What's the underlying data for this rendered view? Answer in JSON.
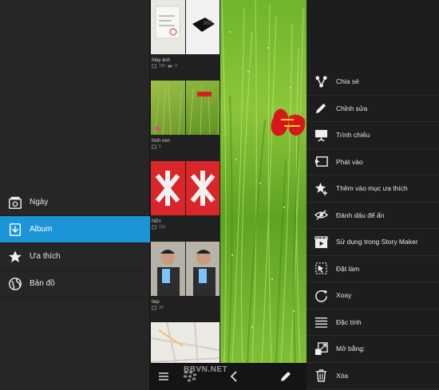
{
  "nav": {
    "items": [
      {
        "label": "Ngày",
        "icon": "calendar-photo-icon",
        "active": false
      },
      {
        "label": "Album",
        "icon": "album-icon",
        "active": true
      },
      {
        "label": "Ưa thích",
        "icon": "star-icon",
        "active": false
      },
      {
        "label": "Bản đồ",
        "icon": "globe-icon",
        "active": false
      }
    ]
  },
  "albums": [
    {
      "name": "Máy ảnh",
      "photos": "160",
      "videos": "6"
    },
    {
      "name": "hinh nen",
      "photos": "5"
    },
    {
      "name": "NEn",
      "photos": "102"
    },
    {
      "name": "tiep",
      "photos": "30"
    }
  ],
  "watermark": "BBVN.NET",
  "menu": {
    "items": [
      {
        "label": "Chia sẻ",
        "icon": "share-icon"
      },
      {
        "label": "Chỉnh sửa",
        "icon": "pencil-icon"
      },
      {
        "label": "Trình chiếu",
        "icon": "slideshow-icon"
      },
      {
        "label": "Phát vào",
        "icon": "play-on-icon"
      },
      {
        "label": "Thêm vào mục ưa thích",
        "icon": "add-favorite-icon"
      },
      {
        "label": "Đánh dấu để ẩn",
        "icon": "hide-icon"
      },
      {
        "label": "Sử dụng trong Story Maker",
        "icon": "story-maker-icon"
      },
      {
        "label": "Đặt làm",
        "icon": "set-as-icon"
      },
      {
        "label": "Xoay",
        "icon": "rotate-icon"
      },
      {
        "label": "Đặc tính",
        "icon": "properties-icon"
      },
      {
        "label": "Mở bằng:",
        "icon": "open-with-icon"
      },
      {
        "label": "Xóa",
        "icon": "trash-icon"
      }
    ]
  },
  "colors": {
    "accent": "#1b95d8",
    "background": "#1d1d1d",
    "text": "#e6e6e6"
  }
}
